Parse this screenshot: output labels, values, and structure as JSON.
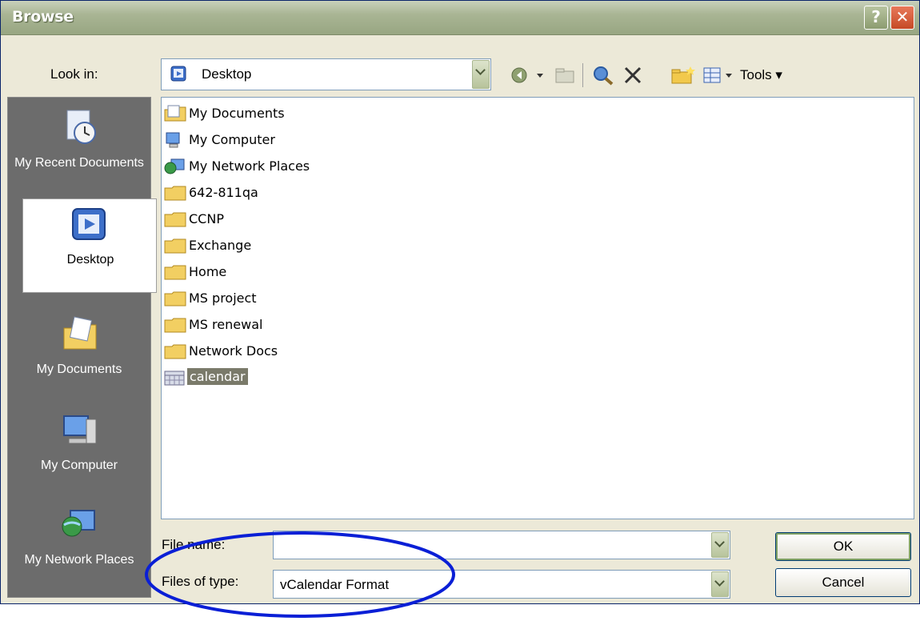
{
  "window": {
    "title": "Browse"
  },
  "lookin": {
    "label": "Look in:",
    "value": "Desktop"
  },
  "toolbar": {
    "tools_label": "Tools"
  },
  "places": [
    {
      "label": "My Recent Documents",
      "icon": "recent-documents-icon"
    },
    {
      "label": "Desktop",
      "icon": "desktop-icon",
      "active": true
    },
    {
      "label": "My Documents",
      "icon": "my-documents-icon"
    },
    {
      "label": "My Computer",
      "icon": "my-computer-icon"
    },
    {
      "label": "My Network Places",
      "icon": "network-places-icon"
    }
  ],
  "files": [
    {
      "name": "My Documents",
      "icon": "my-documents-icon"
    },
    {
      "name": "My Computer",
      "icon": "my-computer-icon"
    },
    {
      "name": "My Network Places",
      "icon": "network-places-icon"
    },
    {
      "name": "642-811qa",
      "icon": "folder-icon"
    },
    {
      "name": "CCNP",
      "icon": "folder-icon"
    },
    {
      "name": "Exchange",
      "icon": "folder-icon"
    },
    {
      "name": "Home",
      "icon": "folder-icon"
    },
    {
      "name": "MS project",
      "icon": "folder-icon"
    },
    {
      "name": "MS renewal",
      "icon": "folder-icon"
    },
    {
      "name": "Network Docs",
      "icon": "folder-icon"
    },
    {
      "name": "calendar",
      "icon": "calendar-file-icon",
      "selected": true
    }
  ],
  "filename": {
    "label": "File name:",
    "value": ""
  },
  "filetype": {
    "label": "Files of type:",
    "value": "vCalendar Format"
  },
  "buttons": {
    "ok": "OK",
    "cancel": "Cancel"
  },
  "annotation": {
    "color": "#0a1fd6"
  }
}
